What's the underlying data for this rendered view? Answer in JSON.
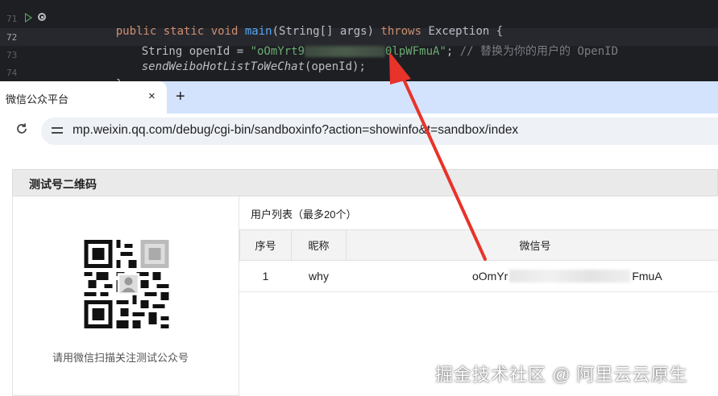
{
  "ide": {
    "line_numbers": [
      "71",
      "72",
      "73",
      "74"
    ],
    "line71": {
      "mods": "public static void ",
      "fn": "main",
      "params": "(String[] args) ",
      "throws": "throws",
      "rest": " Exception {"
    },
    "line72": {
      "decl": "String openId = ",
      "str_start": "\"oOmYrt9",
      "str_end": "0lpWFmuA\"",
      "semi": "; ",
      "comment": "// 替换为你的用户的 OpenID"
    },
    "line73": {
      "call": "sendWeiboHotListToWeChat",
      "args": "(openId);"
    },
    "line74": {
      "brace": "}"
    }
  },
  "browser": {
    "tab_title": "微信公众平台",
    "tab_close": "×",
    "new_tab": "+",
    "reload": "C",
    "url": "mp.weixin.qq.com/debug/cgi-bin/sandboxinfo?action=showinfo&t=sandbox/index"
  },
  "page": {
    "qr_panel_title": "测试号二维码",
    "qr_caption": "请用微信扫描关注测试公众号",
    "user_list_title": "用户列表（最多20个）",
    "table": {
      "headers": [
        "序号",
        "昵称",
        "微信号"
      ],
      "rows": [
        {
          "index": "1",
          "nickname": "why",
          "openid_start": "oOmYr",
          "openid_end": "FmuA"
        }
      ]
    }
  },
  "watermark": "掘金技术社区 @ 阿里云云原生",
  "colors": {
    "ide_bg": "#1e1f22",
    "arrow": "#e8332a",
    "tabbar": "#d3e3fd"
  }
}
